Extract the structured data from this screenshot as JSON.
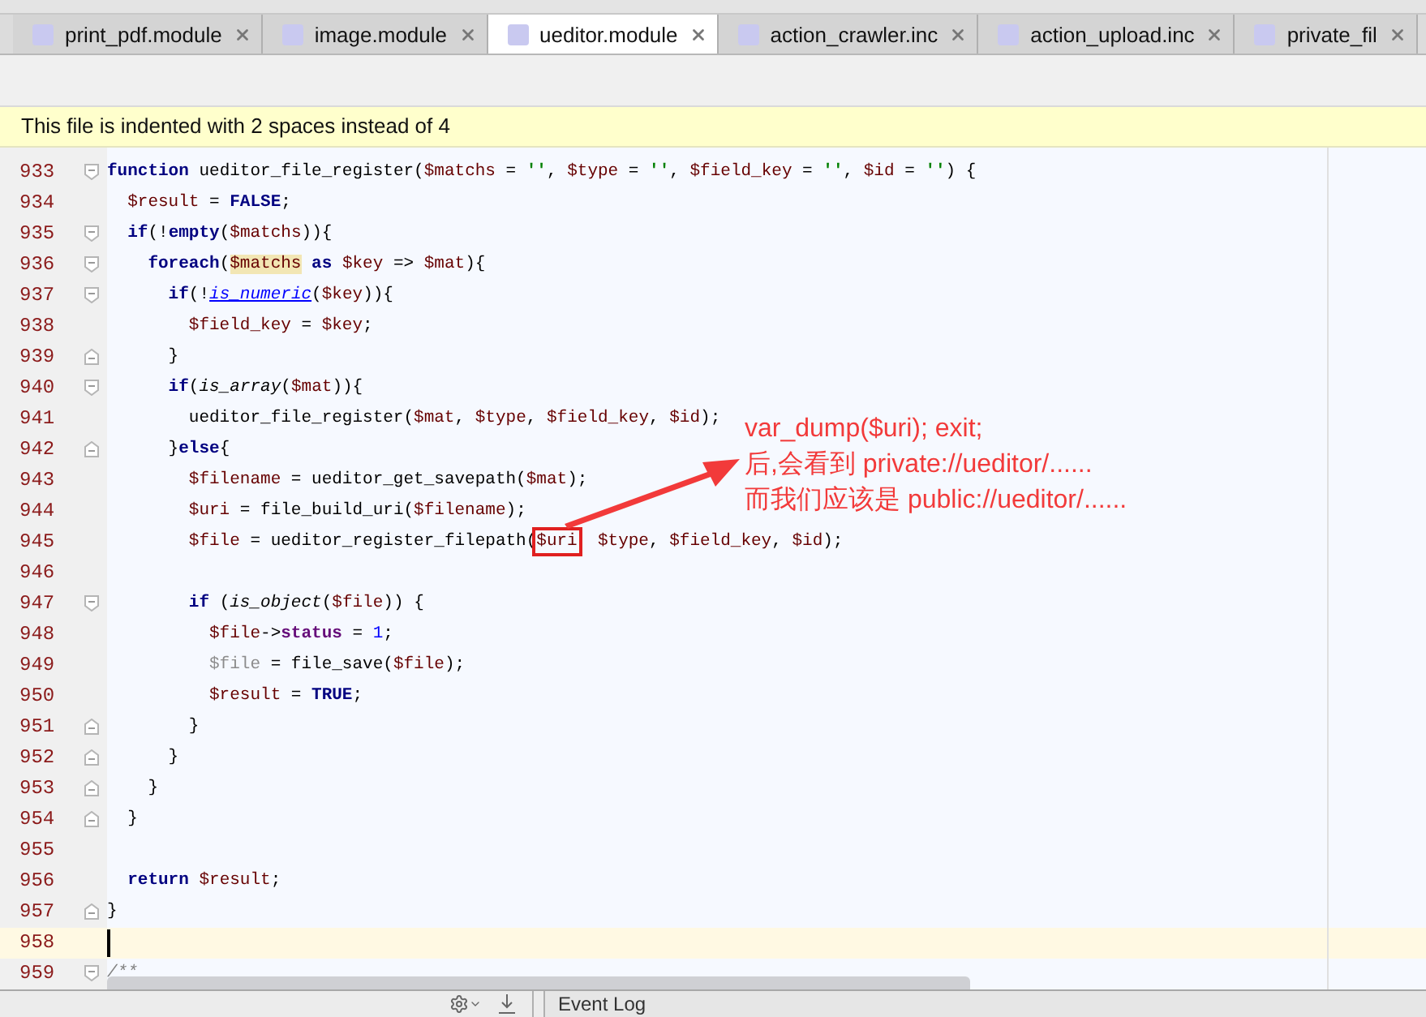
{
  "tabs": [
    {
      "label": "print_pdf.module",
      "selected": false
    },
    {
      "label": "image.module",
      "selected": false
    },
    {
      "label": "ueditor.module",
      "selected": true
    },
    {
      "label": "action_crawler.inc",
      "selected": false
    },
    {
      "label": "action_upload.inc",
      "selected": false
    },
    {
      "label": "private_fil",
      "selected": false
    }
  ],
  "notification": "This file is indented with 2 spaces instead of 4",
  "lines": [
    {
      "number": "933",
      "fold": {
        "kind": "start"
      },
      "current": false,
      "tokens": [
        {
          "kind": "kw",
          "text": "function"
        },
        {
          "kind": "plain",
          "text": " ueditor_file_register("
        },
        {
          "kind": "var",
          "text": "$matchs"
        },
        {
          "kind": "plain",
          "text": " = "
        },
        {
          "kind": "str",
          "text": "''"
        },
        {
          "kind": "plain",
          "text": ", "
        },
        {
          "kind": "var",
          "text": "$type"
        },
        {
          "kind": "plain",
          "text": " = "
        },
        {
          "kind": "str",
          "text": "''"
        },
        {
          "kind": "plain",
          "text": ", "
        },
        {
          "kind": "var",
          "text": "$field_key"
        },
        {
          "kind": "plain",
          "text": " = "
        },
        {
          "kind": "str",
          "text": "''"
        },
        {
          "kind": "plain",
          "text": ", "
        },
        {
          "kind": "var",
          "text": "$id"
        },
        {
          "kind": "plain",
          "text": " = "
        },
        {
          "kind": "str",
          "text": "''"
        },
        {
          "kind": "plain",
          "text": ") {"
        }
      ]
    },
    {
      "number": "934",
      "current": false,
      "tokens": [
        {
          "kind": "var",
          "text": "  $result"
        },
        {
          "kind": "plain",
          "text": " = "
        },
        {
          "kind": "const",
          "text": "FALSE"
        },
        {
          "kind": "plain",
          "text": ";"
        }
      ]
    },
    {
      "number": "935",
      "fold": {
        "kind": "start"
      },
      "current": false,
      "tokens": [
        {
          "kind": "kw",
          "text": "  if"
        },
        {
          "kind": "plain",
          "text": "(!"
        },
        {
          "kind": "kw",
          "text": "empty"
        },
        {
          "kind": "plain",
          "text": "("
        },
        {
          "kind": "var",
          "text": "$matchs"
        },
        {
          "kind": "plain",
          "text": ")){"
        }
      ]
    },
    {
      "number": "936",
      "fold": {
        "kind": "start"
      },
      "current": false,
      "tokens": [
        {
          "kind": "kw",
          "text": "    foreach"
        },
        {
          "kind": "plain",
          "text": "("
        },
        {
          "kind": "match",
          "text": "$matchs"
        },
        {
          "kind": "kw",
          "text": " as"
        },
        {
          "kind": "var",
          "text": " $key"
        },
        {
          "kind": "plain",
          "text": " => "
        },
        {
          "kind": "var",
          "text": "$mat"
        },
        {
          "kind": "plain",
          "text": "){"
        }
      ]
    },
    {
      "number": "937",
      "fold": {
        "kind": "start"
      },
      "current": false,
      "tokens": [
        {
          "kind": "kw",
          "text": "      if"
        },
        {
          "kind": "plain",
          "text": "(!"
        },
        {
          "kind": "link",
          "text": "is_numeric"
        },
        {
          "kind": "plain",
          "text": "("
        },
        {
          "kind": "var",
          "text": "$key"
        },
        {
          "kind": "plain",
          "text": ")){"
        }
      ]
    },
    {
      "number": "938",
      "current": false,
      "tokens": [
        {
          "kind": "var",
          "text": "        $field_key"
        },
        {
          "kind": "plain",
          "text": " = "
        },
        {
          "kind": "var",
          "text": "$key"
        },
        {
          "kind": "plain",
          "text": ";"
        }
      ]
    },
    {
      "number": "939",
      "fold": {
        "kind": "end"
      },
      "current": false,
      "tokens": [
        {
          "kind": "plain",
          "text": "      }"
        }
      ]
    },
    {
      "number": "940",
      "fold": {
        "kind": "start"
      },
      "current": false,
      "tokens": [
        {
          "kind": "kw",
          "text": "      if"
        },
        {
          "kind": "plain",
          "text": "("
        },
        {
          "kind": "italic",
          "text": "is_array"
        },
        {
          "kind": "plain",
          "text": "("
        },
        {
          "kind": "var",
          "text": "$mat"
        },
        {
          "kind": "plain",
          "text": ")){"
        }
      ]
    },
    {
      "number": "941",
      "current": false,
      "tokens": [
        {
          "kind": "plain",
          "text": "        ueditor_file_register("
        },
        {
          "kind": "var",
          "text": "$mat"
        },
        {
          "kind": "plain",
          "text": ", "
        },
        {
          "kind": "var",
          "text": "$type"
        },
        {
          "kind": "plain",
          "text": ", "
        },
        {
          "kind": "var",
          "text": "$field_key"
        },
        {
          "kind": "plain",
          "text": ", "
        },
        {
          "kind": "var",
          "text": "$id"
        },
        {
          "kind": "plain",
          "text": ");"
        }
      ]
    },
    {
      "number": "942",
      "fold": {
        "kind": "end"
      },
      "current": false,
      "tokens": [
        {
          "kind": "plain",
          "text": "      }"
        },
        {
          "kind": "kw",
          "text": "else"
        },
        {
          "kind": "plain",
          "text": "{"
        }
      ]
    },
    {
      "number": "943",
      "current": false,
      "tokens": [
        {
          "kind": "var",
          "text": "        $filename"
        },
        {
          "kind": "plain",
          "text": " = ueditor_get_savepath("
        },
        {
          "kind": "var",
          "text": "$mat"
        },
        {
          "kind": "plain",
          "text": ");"
        }
      ]
    },
    {
      "number": "944",
      "current": false,
      "tokens": [
        {
          "kind": "var",
          "text": "        $uri"
        },
        {
          "kind": "plain",
          "text": " = file_build_uri("
        },
        {
          "kind": "var",
          "text": "$filename"
        },
        {
          "kind": "plain",
          "text": ");"
        }
      ]
    },
    {
      "number": "945",
      "current": false,
      "tokens": [
        {
          "kind": "var",
          "text": "        $file"
        },
        {
          "kind": "plain",
          "text": " = ueditor_register_filepath("
        },
        {
          "kind": "boxed",
          "text": "$uri"
        },
        {
          "kind": "var",
          "text": "  $type"
        },
        {
          "kind": "plain",
          "text": ", "
        },
        {
          "kind": "var",
          "text": "$field_key"
        },
        {
          "kind": "plain",
          "text": ", "
        },
        {
          "kind": "var",
          "text": "$id"
        },
        {
          "kind": "plain",
          "text": ");"
        }
      ]
    },
    {
      "number": "946",
      "current": false
    },
    {
      "number": "947",
      "fold": {
        "kind": "start"
      },
      "current": false,
      "tokens": [
        {
          "kind": "kw",
          "text": "        if"
        },
        {
          "kind": "plain",
          "text": " ("
        },
        {
          "kind": "italic",
          "text": "is_object"
        },
        {
          "kind": "plain",
          "text": "("
        },
        {
          "kind": "var",
          "text": "$file"
        },
        {
          "kind": "plain",
          "text": ")) {"
        }
      ]
    },
    {
      "number": "948",
      "current": false,
      "tokens": [
        {
          "kind": "var",
          "text": "          $file"
        },
        {
          "kind": "plain",
          "text": "->"
        },
        {
          "kind": "field",
          "text": "status"
        },
        {
          "kind": "plain",
          "text": " = "
        },
        {
          "kind": "num",
          "text": "1"
        },
        {
          "kind": "plain",
          "text": ";"
        }
      ]
    },
    {
      "number": "949",
      "current": false,
      "tokens": [
        {
          "kind": "unused",
          "text": "          $file"
        },
        {
          "kind": "plain",
          "text": " = file_save("
        },
        {
          "kind": "var",
          "text": "$file"
        },
        {
          "kind": "plain",
          "text": ");"
        }
      ]
    },
    {
      "number": "950",
      "current": false,
      "tokens": [
        {
          "kind": "var",
          "text": "          $result"
        },
        {
          "kind": "plain",
          "text": " = "
        },
        {
          "kind": "const",
          "text": "TRUE"
        },
        {
          "kind": "plain",
          "text": ";"
        }
      ]
    },
    {
      "number": "951",
      "fold": {
        "kind": "end"
      },
      "current": false,
      "tokens": [
        {
          "kind": "plain",
          "text": "        }"
        }
      ]
    },
    {
      "number": "952",
      "fold": {
        "kind": "end"
      },
      "current": false,
      "tokens": [
        {
          "kind": "plain",
          "text": "      }"
        }
      ]
    },
    {
      "number": "953",
      "fold": {
        "kind": "end"
      },
      "current": false,
      "tokens": [
        {
          "kind": "plain",
          "text": "    }"
        }
      ]
    },
    {
      "number": "954",
      "fold": {
        "kind": "end"
      },
      "current": false,
      "tokens": [
        {
          "kind": "plain",
          "text": "  }"
        }
      ]
    },
    {
      "number": "955",
      "current": false
    },
    {
      "number": "956",
      "current": false,
      "tokens": [
        {
          "kind": "kw",
          "text": "  return"
        },
        {
          "kind": "var",
          "text": " $result"
        },
        {
          "kind": "plain",
          "text": ";"
        }
      ]
    },
    {
      "number": "957",
      "fold": {
        "kind": "end"
      },
      "current": false,
      "tokens": [
        {
          "kind": "plain",
          "text": "}"
        }
      ]
    },
    {
      "number": "958",
      "current": true
    },
    {
      "number": "959",
      "fold": {
        "kind": "start"
      },
      "current": false,
      "tokens": [
        {
          "kind": "comment",
          "text": "/**"
        }
      ]
    }
  ],
  "annotation": [
    "var_dump($uri); exit;",
    "后,会看到  private://ueditor/......",
    "而我们应该是 public://ueditor/......"
  ],
  "status_bar": {
    "event_log": "Event Log"
  }
}
